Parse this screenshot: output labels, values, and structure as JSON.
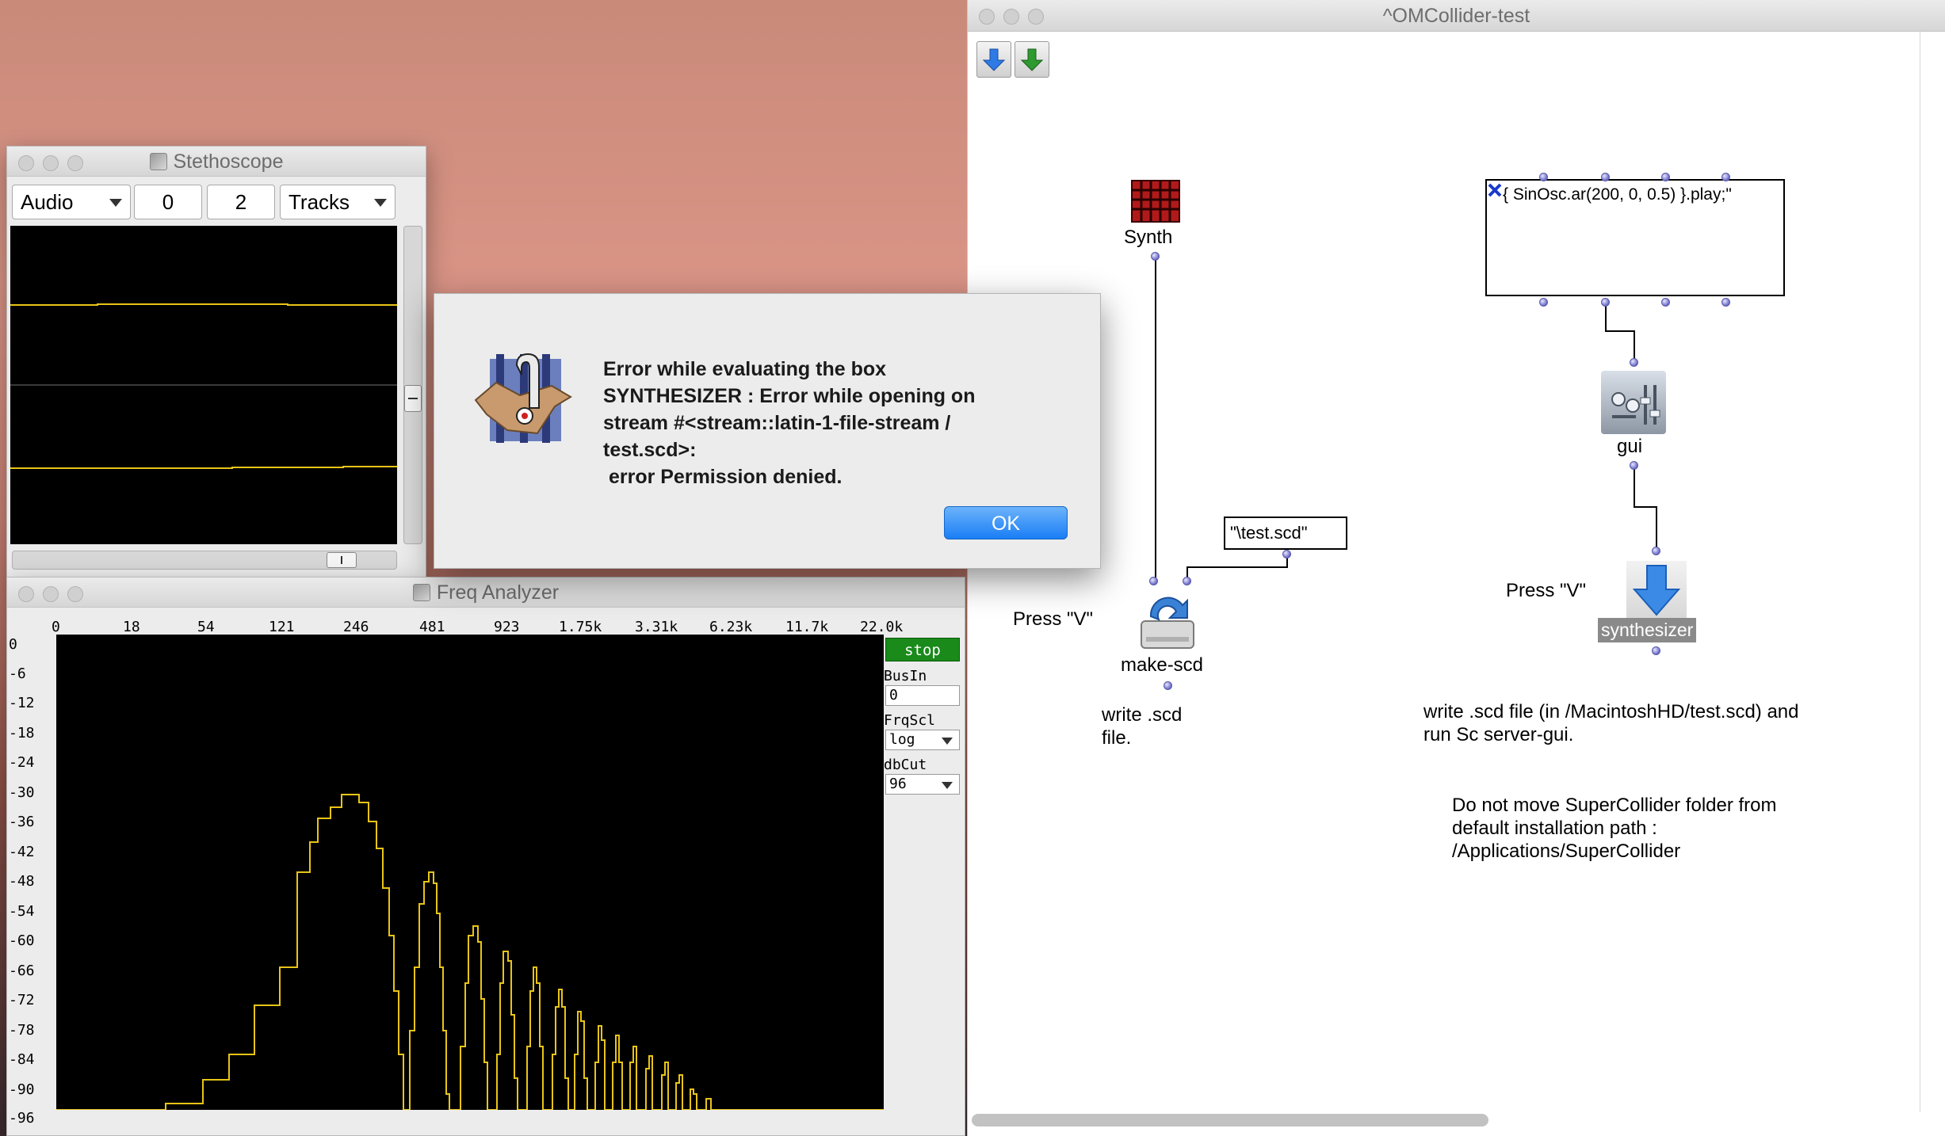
{
  "stethoscope": {
    "title": "Stethoscope",
    "rate": "Audio",
    "index": "0",
    "num_channels": "2",
    "layout": "Tracks"
  },
  "freq_analyzer": {
    "title": "Freq Analyzer",
    "x_ticks": [
      "0",
      "18",
      "54",
      "121",
      "246",
      "481",
      "923",
      "1.75k",
      "3.31k",
      "6.23k",
      "11.7k",
      "22.0k"
    ],
    "y_ticks": [
      "0",
      "-6",
      "-12",
      "-18",
      "-24",
      "-30",
      "-36",
      "-42",
      "-48",
      "-54",
      "-60",
      "-66",
      "-72",
      "-78",
      "-84",
      "-90",
      "-96"
    ],
    "stop_label": "stop",
    "busin_label": "BusIn",
    "busin_value": "0",
    "frqscl_label": "FrqScl",
    "frqscl_value": "log",
    "dbcut_label": "dbCut",
    "dbcut_value": "96",
    "trace_color": "#e8c417"
  },
  "om_window": {
    "title": "^OMCollider-test",
    "synth_label": "Synth",
    "code_box": "{ SinOsc.ar(200, 0, 0.5) }.play;\"",
    "gui_label": "gui",
    "string_box": "\"\\test.scd\"",
    "press_v_left": "Press \"V\"",
    "press_v_right": "Press \"V\"",
    "make_scd_label": "make-scd",
    "synthesizer_label": "synthesizer",
    "comment_write": "write .scd\nfile.",
    "comment_write_run": "write .scd file (in /MacintoshHD/test.scd) and\nrun Sc server-gui.",
    "comment_warning": "Do not move SuperCollider folder from\ndefault installation path :\n/Applications/SuperCollider"
  },
  "dialog": {
    "message": "Error while evaluating the box\nSYNTHESIZER : Error while opening on\nstream #<stream::latin-1-file-stream /\ntest.scd>:\n error Permission denied.",
    "ok_label": "OK"
  }
}
